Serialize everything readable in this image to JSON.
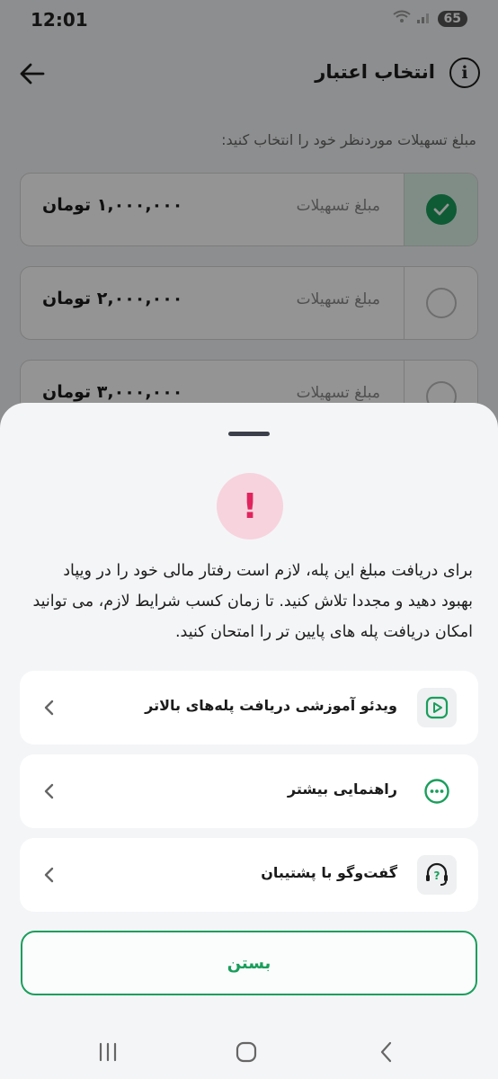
{
  "status_bar": {
    "time": "12:01",
    "battery": "65"
  },
  "header": {
    "title": "انتخاب اعتبار"
  },
  "prompt": "مبلغ تسهیلات موردنظر خود را انتخاب کنید:",
  "options": [
    {
      "label": "مبلغ تسهیلات",
      "amount": "۱,۰۰۰,۰۰۰ تومان",
      "selected": true
    },
    {
      "label": "مبلغ تسهیلات",
      "amount": "۲,۰۰۰,۰۰۰ تومان",
      "selected": false
    },
    {
      "label": "مبلغ تسهیلات",
      "amount": "۳,۰۰۰,۰۰۰ تومان",
      "selected": false
    }
  ],
  "sheet": {
    "alert_mark": "!",
    "message": "برای دریافت مبلغ این پله، لازم است رفتار مالی خود را در ویپاد بهبود دهید و مجددا تلاش کنید. تا زمان کسب شرایط لازم، می توانید امکان دریافت پله های پایین تر را امتحان کنید.",
    "rows": [
      {
        "label": "ویدئو آموزشی دریافت پله‌های بالاتر",
        "icon": "play-video-icon"
      },
      {
        "label": "راهنمایی بیشتر",
        "icon": "more-dots-icon"
      },
      {
        "label": "گفت‌وگو با پشتیبان",
        "icon": "support-headset-icon"
      }
    ],
    "close_label": "بستن"
  },
  "colors": {
    "accent": "#1a9e5c",
    "alert": "#e0245e",
    "alert_bg": "#f7d3dd",
    "selected_bg": "#dcf3e8"
  }
}
